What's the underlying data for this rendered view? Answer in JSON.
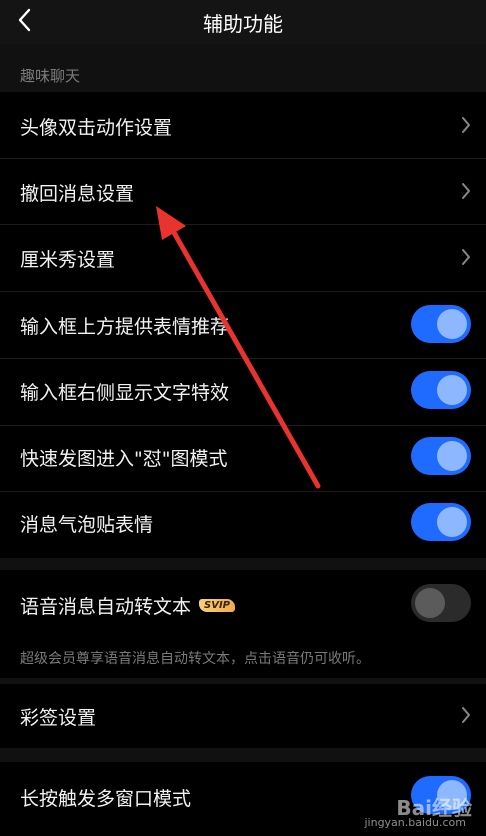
{
  "header": {
    "title": "辅助功能",
    "back_icon": "chevron-left-icon"
  },
  "section": {
    "label": "趣味聊天"
  },
  "rows": [
    {
      "label": "头像双击动作设置",
      "control": "chevron"
    },
    {
      "label": "撤回消息设置",
      "control": "chevron"
    },
    {
      "label": "厘米秀设置",
      "control": "chevron"
    },
    {
      "label": "输入框上方提供表情推荐",
      "control": "toggle",
      "on": true
    },
    {
      "label": "输入框右侧显示文字特效",
      "control": "toggle",
      "on": true
    },
    {
      "label": "快速发图进入\"怼\"图模式",
      "control": "toggle",
      "on": true
    },
    {
      "label": "消息气泡贴表情",
      "control": "toggle",
      "on": true
    },
    {
      "label": "语音消息自动转文本",
      "control": "toggle",
      "on": false,
      "badge": "SVIP"
    },
    {
      "label": "彩签设置",
      "control": "chevron"
    },
    {
      "label": "长按触发多窗口模式",
      "control": "toggle",
      "on": true
    }
  ],
  "voice_note": "超级会员尊享语音消息自动转文本，点击语音仍可收听。",
  "colors": {
    "toggle_on": "#1f6bff",
    "toggle_off": "#2b2b2b",
    "background": "#000000",
    "arrow": "#e8332f"
  },
  "watermark": {
    "brand": "Bai经验",
    "url": "jingyan.baidu.com"
  }
}
